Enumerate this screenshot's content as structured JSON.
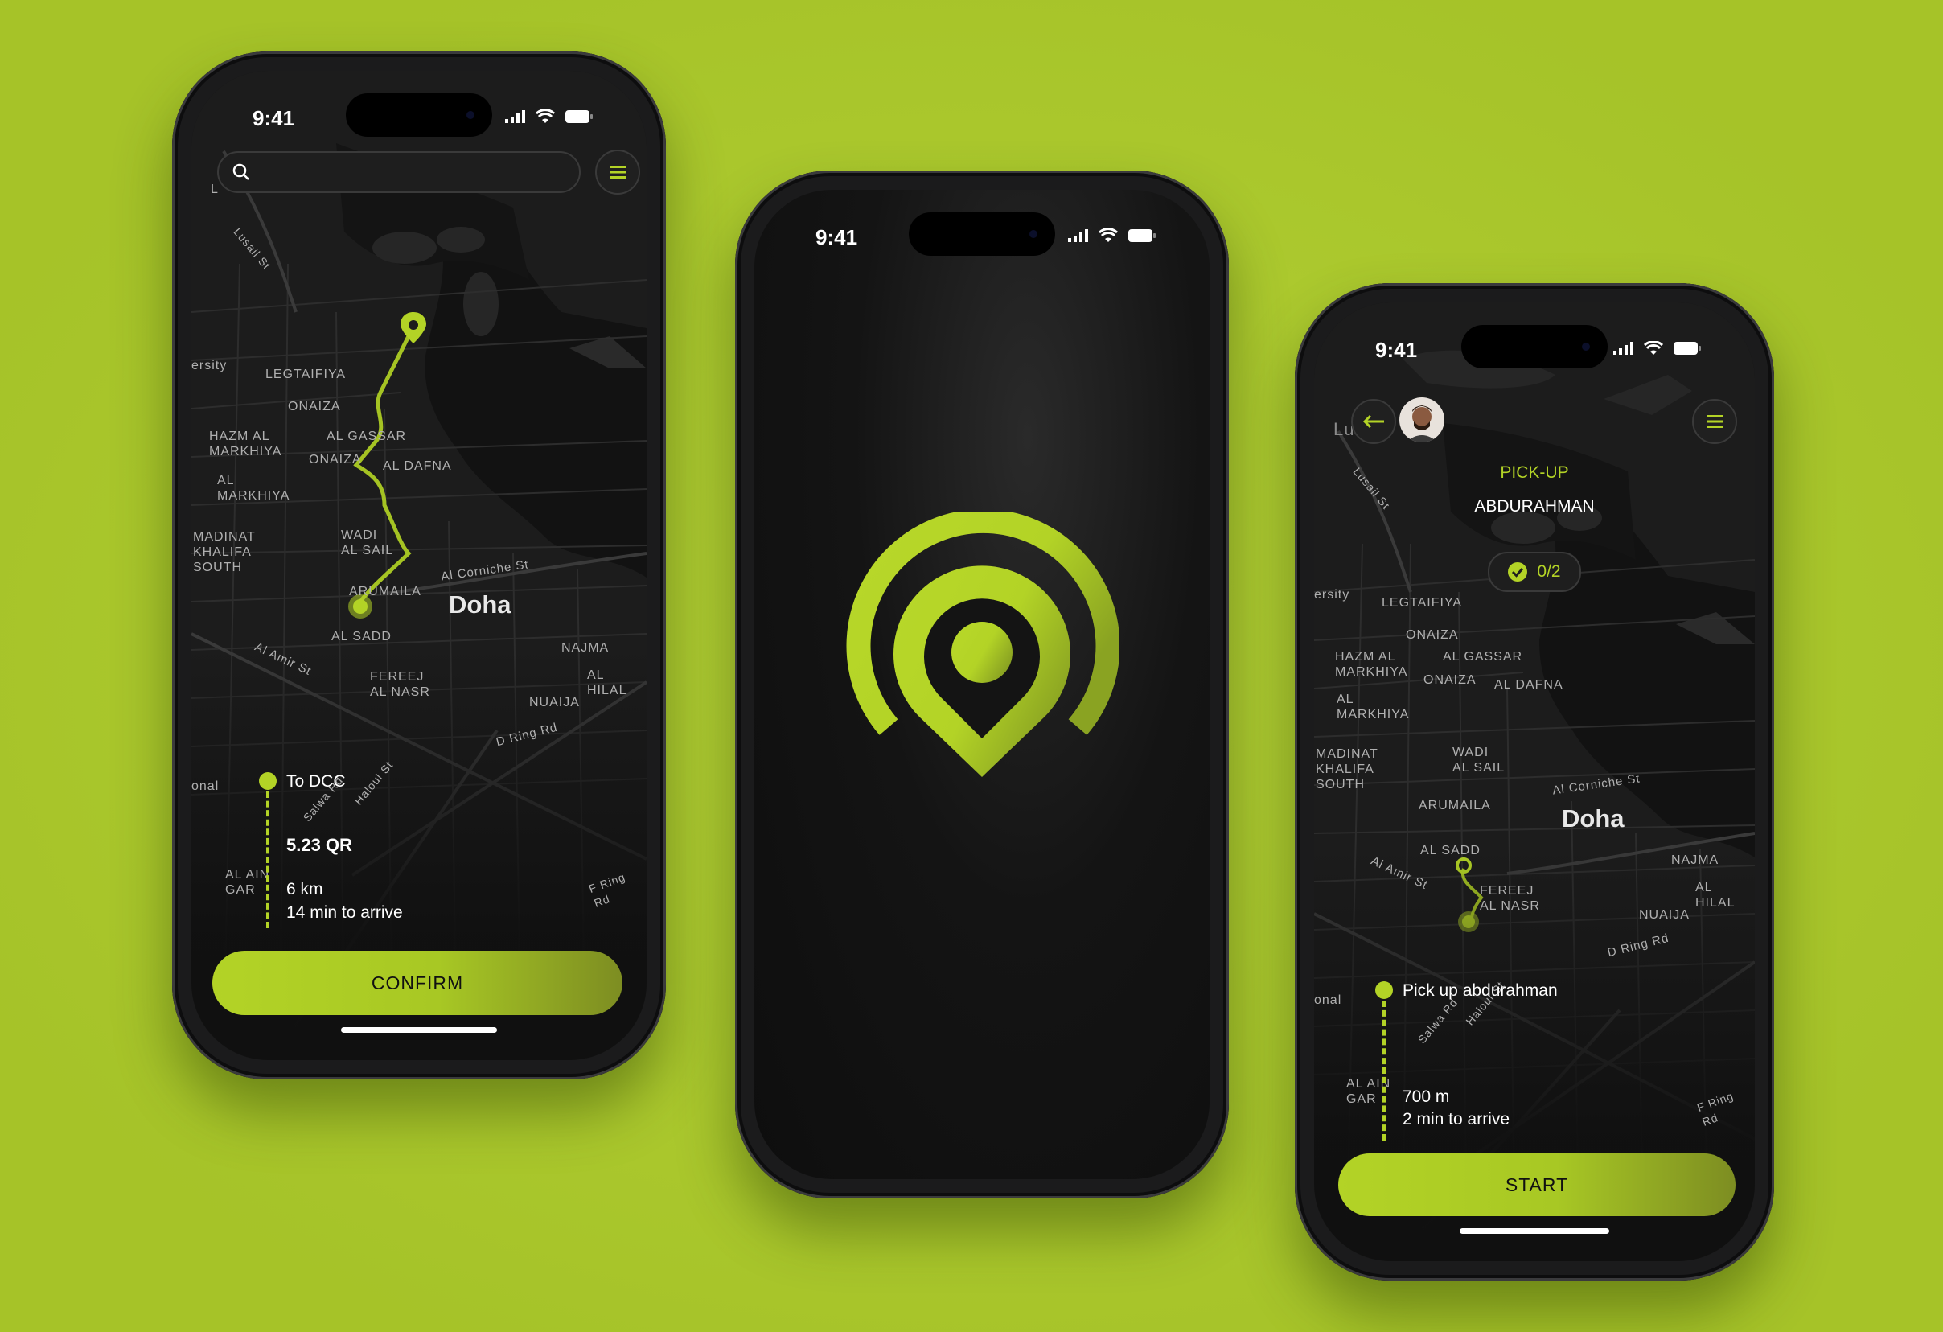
{
  "colors": {
    "accent": "#b3d326",
    "background": "#b0cf2b",
    "screen": "#151515"
  },
  "status": {
    "time": "9:41"
  },
  "phone_left": {
    "search_placeholder": "",
    "menu_icon": "hamburger-icon",
    "map": {
      "city": "Doha",
      "districts": [
        "LEGTAIFIYA",
        "ONAIZA",
        "HAZM AL MARKHIYA",
        "AL GASSAR",
        "ONAIZA",
        "AL DAFNA",
        "AL MARKHIYA",
        "MADINAT KHALIFA SOUTH",
        "WADI AL SAIL",
        "ARUMAILA",
        "AL SADD",
        "FEREEJ AL NASR",
        "NAJMA",
        "AL HILAL",
        "NUAIJA"
      ],
      "roads": [
        "Lusail St",
        "Al Corniche St",
        "Al Amir St",
        "D Ring Rd",
        "Salwa Rd",
        "Haloul St",
        "F Ring Rd"
      ],
      "edge_labels": [
        "L",
        "ersity",
        "onal",
        "AL AIN GAR"
      ]
    },
    "trip": {
      "destination": "To DCC",
      "price": "5.23 QR",
      "distance": "6 km",
      "eta": "14 min to arrive"
    },
    "cta": "CONFIRM"
  },
  "phone_middle": {
    "logo": "location-pin-signal-logo"
  },
  "phone_right": {
    "back_icon": "arrow-left-icon",
    "avatar": "user-avatar",
    "menu_icon": "hamburger-icon",
    "mode_label": "PICK-UP",
    "passenger": "ABDURAHMAN",
    "progress_badge": "0/2",
    "map": {
      "city": "Doha",
      "districts": [
        "LEGTAIFIYA",
        "ONAIZA",
        "HAZM AL MARKHIYA",
        "AL GASSAR",
        "ONAIZA",
        "AL DAFNA",
        "AL MARKHIYA",
        "MADINAT KHALIFA SOUTH",
        "WADI AL SAIL",
        "ARUMAILA",
        "AL SADD",
        "FEREEJ AL NASR",
        "NAJMA",
        "AL HILAL",
        "NUAIJA"
      ],
      "roads": [
        "Lusail St",
        "Al Corniche St",
        "Al Amir St",
        "D Ring Rd",
        "Salwa Rd",
        "Haloul St",
        "F Ring Rd"
      ],
      "edge_labels": [
        "Lu",
        "ersity",
        "onal",
        "AL AIN GAR"
      ]
    },
    "trip": {
      "title": "Pick up abdurahman",
      "distance": "700 m",
      "eta": "2 min to arrive"
    },
    "cta": "START"
  }
}
